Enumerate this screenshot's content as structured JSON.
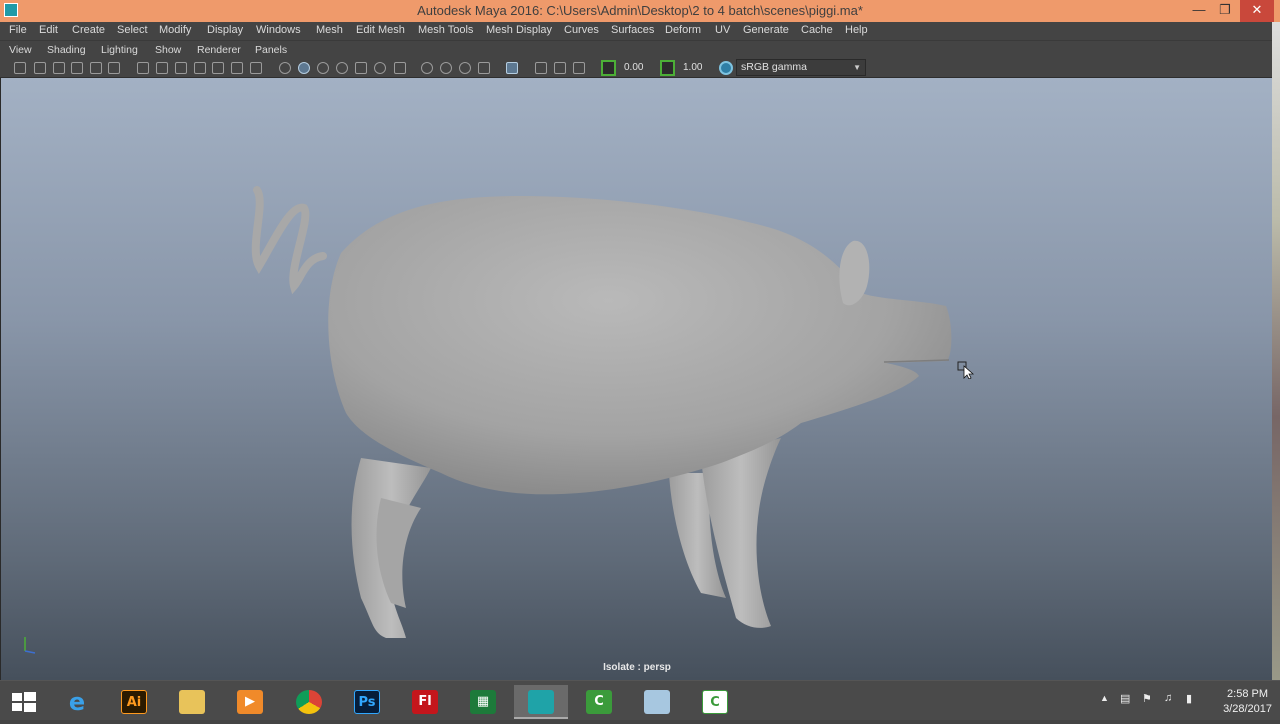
{
  "window": {
    "title": "Autodesk Maya 2016: C:\\Users\\Admin\\Desktop\\2 to 4 batch\\scenes\\piggi.ma*"
  },
  "menu": [
    "File",
    "Edit",
    "Create",
    "Select",
    "Modify",
    "Display",
    "Windows",
    "Mesh",
    "Edit Mesh",
    "Mesh Tools",
    "Mesh Display",
    "Curves",
    "Surfaces",
    "Deform",
    "UV",
    "Generate",
    "Cache",
    "Help"
  ],
  "panel_menu": [
    "View",
    "Shading",
    "Lighting",
    "Show",
    "Renderer",
    "Panels"
  ],
  "toolbar": {
    "exposure": "0.00",
    "gamma_value": "1.00",
    "color_space": "sRGB gamma"
  },
  "viewport": {
    "status": "Isolate : persp"
  },
  "taskbar": {
    "apps": [
      "windows-start",
      "internet-explorer",
      "illustrator",
      "file-explorer",
      "media-player",
      "chrome",
      "photoshop",
      "flash",
      "excel",
      "maya",
      "camtasia",
      "notepad",
      "camtasia-recorder"
    ],
    "app_labels": {
      "illustrator": "Ai",
      "photoshop": "Ps",
      "flash": "Fl"
    },
    "time": "2:58 PM",
    "date": "3/28/2017"
  }
}
